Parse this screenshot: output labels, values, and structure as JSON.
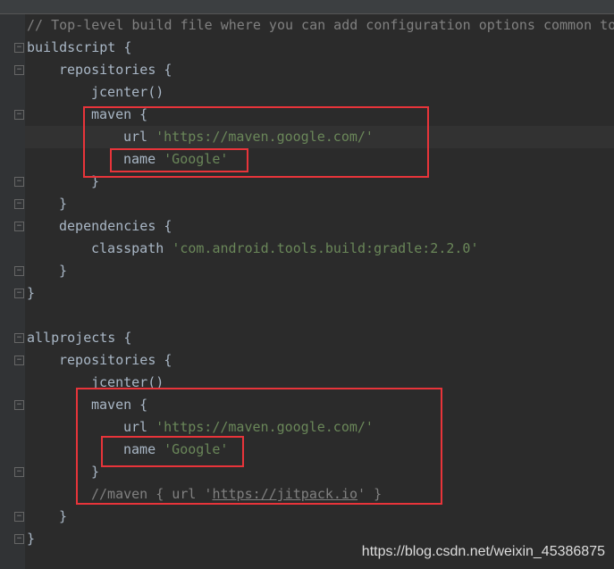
{
  "editor": {
    "lines": [
      {
        "indent": 0,
        "parts": [
          [
            "cm",
            "// Top-level build file where you can add configuration options common to"
          ]
        ]
      },
      {
        "indent": 0,
        "parts": [
          [
            "",
            "buildscript {"
          ]
        ],
        "fold": "open"
      },
      {
        "indent": 1,
        "parts": [
          [
            "",
            "repositories {"
          ]
        ],
        "fold": "open"
      },
      {
        "indent": 2,
        "parts": [
          [
            "",
            "jcenter()"
          ]
        ]
      },
      {
        "indent": 2,
        "parts": [
          [
            "",
            "maven {"
          ]
        ],
        "fold": "open"
      },
      {
        "indent": 3,
        "parts": [
          [
            "",
            "url "
          ],
          [
            "str",
            "'https://maven.google.com/'"
          ]
        ]
      },
      {
        "indent": 3,
        "parts": [
          [
            "",
            "name "
          ],
          [
            "str",
            "'Google'"
          ]
        ]
      },
      {
        "indent": 2,
        "parts": [
          [
            "",
            "}"
          ]
        ],
        "fold": "close"
      },
      {
        "indent": 1,
        "parts": [
          [
            "",
            "}"
          ]
        ],
        "fold": "close"
      },
      {
        "indent": 1,
        "parts": [
          [
            "",
            "dependencies {"
          ]
        ],
        "fold": "open"
      },
      {
        "indent": 2,
        "parts": [
          [
            "",
            "classpath "
          ],
          [
            "str",
            "'com.android.tools.build:gradle:2.2.0'"
          ]
        ]
      },
      {
        "indent": 1,
        "parts": [
          [
            "",
            "}"
          ]
        ],
        "fold": "close"
      },
      {
        "indent": 0,
        "parts": [
          [
            "",
            "}"
          ]
        ],
        "fold": "close"
      },
      {
        "indent": 0,
        "parts": []
      },
      {
        "indent": 0,
        "parts": [
          [
            "",
            "allprojects {"
          ]
        ],
        "fold": "open"
      },
      {
        "indent": 1,
        "parts": [
          [
            "",
            "repositories {"
          ]
        ],
        "fold": "open"
      },
      {
        "indent": 2,
        "parts": [
          [
            "",
            "jcenter()"
          ]
        ]
      },
      {
        "indent": 2,
        "parts": [
          [
            "",
            "maven {"
          ]
        ],
        "fold": "open"
      },
      {
        "indent": 3,
        "parts": [
          [
            "",
            "url "
          ],
          [
            "str",
            "'https://maven.google.com/'"
          ]
        ]
      },
      {
        "indent": 3,
        "parts": [
          [
            "",
            "name "
          ],
          [
            "str",
            "'Google'"
          ]
        ]
      },
      {
        "indent": 2,
        "parts": [
          [
            "",
            "}"
          ]
        ],
        "fold": "close"
      },
      {
        "indent": 2,
        "parts": [
          [
            "cm",
            "//maven { url '"
          ],
          [
            "cm link",
            "https://jitpack.io"
          ],
          [
            "cm",
            "' }"
          ]
        ]
      },
      {
        "indent": 1,
        "parts": [
          [
            "",
            "}"
          ]
        ],
        "fold": "close"
      },
      {
        "indent": 0,
        "parts": [
          [
            "",
            "}"
          ]
        ],
        "fold": "close"
      }
    ]
  },
  "watermark": "https://blog.csdn.net/weixin_45386875",
  "colors": {
    "highlight_box": "#e8343a",
    "string": "#6a8759",
    "comment": "#808080"
  }
}
